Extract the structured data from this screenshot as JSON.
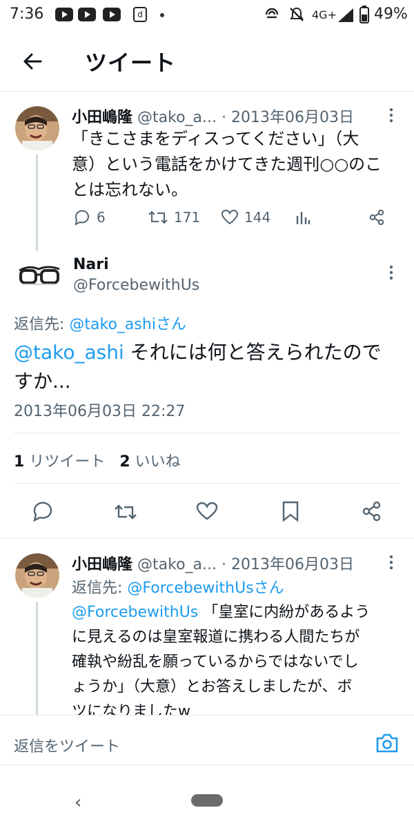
{
  "status_bar": {
    "time": "7:36",
    "network": "4G+",
    "battery": "49%",
    "d_icon": "ⓓ",
    "icons": [
      "youtube-icon",
      "youtube-icon",
      "youtube-icon",
      "d-app-icon",
      "dot-icon",
      "data-saver-icon",
      "mute-icon",
      "signal-icon",
      "battery-icon"
    ]
  },
  "header": {
    "title": "ツイート",
    "back_icon": "arrow-left-icon"
  },
  "tweet1": {
    "name": "小田嶋隆",
    "handle": "@tako_a...",
    "date": "· 2013年06月03日",
    "text_lines": [
      "「きこさまをディスってください」（大",
      "意）という電話をかけてきた週刊○○のこ",
      "とは忘れない。"
    ],
    "replies": "6",
    "retweets": "171",
    "likes": "144"
  },
  "main_tweet": {
    "name": "Nari",
    "handle": "@ForcebewithUs",
    "reply_to_label": "返信先: ",
    "reply_to_user": "@tako_ashiさん",
    "mention": "@tako_ashi",
    "text_line1": " それには何と答えられたので",
    "text_line2": "すか...",
    "timestamp": "2013年06月03日 22:27",
    "retweet_count": "1",
    "retweet_label": "リツイート",
    "like_count": "2",
    "like_label": "いいね"
  },
  "tweet3": {
    "name": "小田嶋隆",
    "handle": "@tako_a...",
    "date": "· 2013年06月03日",
    "reply_to_label": "返信先: ",
    "reply_to_user": "@ForcebewithUsさん",
    "mention": "@ForcebewithUs",
    "text_line1": " 「皇室に内紛があるよう",
    "text_lines": [
      "に見えるのは皇室報道に携わる人間たちが",
      "確執や紛乱を願っているからではないでし",
      "ょうか」（大意）とお答えしましたが、ボ",
      "ツになりましたw"
    ]
  },
  "reply_bar": {
    "placeholder": "返信をツイート",
    "camera_icon": "camera-icon"
  },
  "nav": {
    "back": "‹"
  },
  "colors": {
    "accent": "#1d9bf0",
    "text": "#0f1419",
    "secondary": "#536471"
  }
}
